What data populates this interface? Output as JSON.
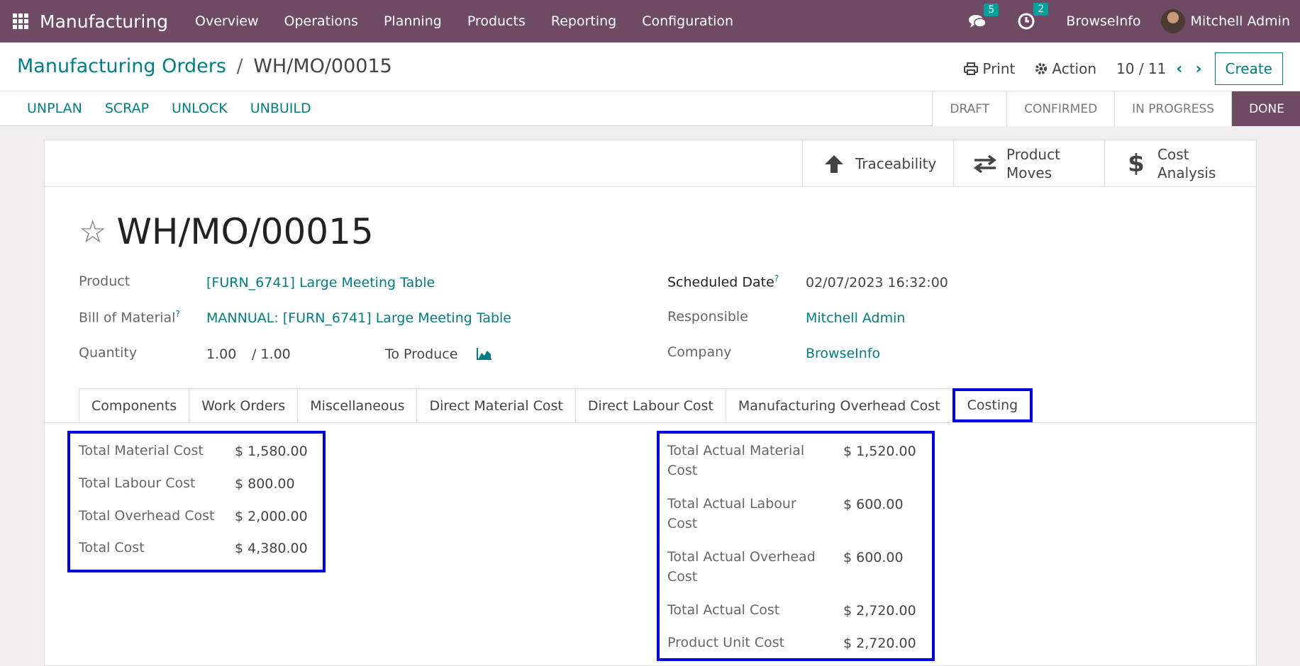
{
  "navbar": {
    "app_name": "Manufacturing",
    "menu": [
      "Overview",
      "Operations",
      "Planning",
      "Products",
      "Reporting",
      "Configuration"
    ],
    "messages_count": "5",
    "activities_count": "2",
    "company": "BrowseInfo",
    "user": "Mitchell Admin"
  },
  "breadcrumb": {
    "parent": "Manufacturing Orders",
    "separator": "/",
    "current": "WH/MO/00015"
  },
  "toolbar": {
    "print_label": "Print",
    "action_label": "Action",
    "pager": "10 / 11",
    "create_label": "Create"
  },
  "actions": [
    "UNPLAN",
    "SCRAP",
    "UNLOCK",
    "UNBUILD"
  ],
  "status": {
    "steps": [
      "DRAFT",
      "CONFIRMED",
      "IN PROGRESS",
      "DONE"
    ],
    "active": "DONE"
  },
  "smart_buttons": {
    "traceability": "Traceability",
    "product_moves_1": "Product",
    "product_moves_2": "Moves",
    "cost_analysis_1": "Cost",
    "cost_analysis_2": "Analysis"
  },
  "record": {
    "title": "WH/MO/00015",
    "product_label": "Product",
    "product": "[FURN_6741] Large Meeting Table",
    "bom_label": "Bill of Material",
    "bom": "MANNUAL: [FURN_6741] Large Meeting Table",
    "quantity_label": "Quantity",
    "quantity": "1.00",
    "quantity_of": "/ 1.00",
    "to_produce": "To Produce",
    "scheduled_label": "Scheduled Date",
    "scheduled": "02/07/2023 16:32:00",
    "responsible_label": "Responsible",
    "responsible": "Mitchell Admin",
    "company_label": "Company",
    "company": "BrowseInfo",
    "help_mark": "?"
  },
  "tabs": [
    "Components",
    "Work Orders",
    "Miscellaneous",
    "Direct Material Cost",
    "Direct Labour Cost",
    "Manufacturing Overhead Cost",
    "Costing"
  ],
  "active_tab": "Costing",
  "costing": {
    "planned": [
      {
        "label": "Total Material Cost",
        "value": "$ 1,580.00"
      },
      {
        "label": "Total Labour Cost",
        "value": "$ 800.00"
      },
      {
        "label": "Total Overhead Cost",
        "value": "$ 2,000.00"
      },
      {
        "label": "Total Cost",
        "value": "$ 4,380.00"
      }
    ],
    "actual": [
      {
        "label1": "Total Actual Material",
        "label2": "Cost",
        "value": "$ 1,520.00"
      },
      {
        "label1": "Total Actual Labour",
        "label2": "Cost",
        "value": "$ 600.00"
      },
      {
        "label1": "Total Actual Overhead",
        "label2": "Cost",
        "value": "$ 600.00"
      },
      {
        "label1": "Total Actual Cost",
        "label2": "",
        "value": "$ 2,720.00"
      },
      {
        "label1": "Product Unit Cost",
        "label2": "",
        "value": "$ 2,720.00"
      }
    ]
  },
  "colors": {
    "brand": "#6e4a64",
    "link": "#017e84",
    "highlight": "#0000e0"
  }
}
